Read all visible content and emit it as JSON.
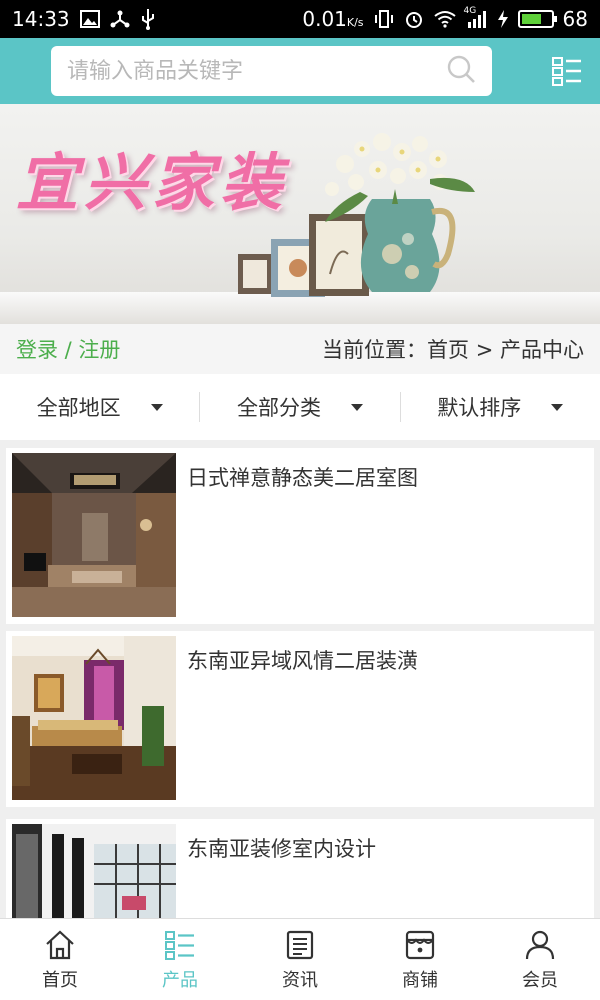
{
  "status_bar": {
    "time": "14:33",
    "net_speed": "0.01",
    "net_unit": "K/s",
    "signal_label": "4G",
    "battery": "68",
    "battery_level": 0.68
  },
  "search": {
    "placeholder": "请输入商品关键字",
    "icon": "search-icon",
    "menu_icon": "list-menu-icon"
  },
  "banner": {
    "title": "宜兴家装"
  },
  "location_bar": {
    "login_link": "登录 / 注册",
    "location": "当前位置：首页 > 产品中心"
  },
  "filters": [
    {
      "label": "全部地区"
    },
    {
      "label": "全部分类"
    },
    {
      "label": "默认排序"
    }
  ],
  "products": [
    {
      "name": "日式禅意静态美二居室图"
    },
    {
      "name": "东南亚异域风情二居装潢"
    },
    {
      "name": "东南亚装修室内设计"
    }
  ],
  "bottom_nav": [
    {
      "label": "首页",
      "icon": "home-icon",
      "active": false
    },
    {
      "label": "产品",
      "icon": "product-list-icon",
      "active": true
    },
    {
      "label": "资讯",
      "icon": "news-icon",
      "active": false
    },
    {
      "label": "商铺",
      "icon": "store-icon",
      "active": false
    },
    {
      "label": "会员",
      "icon": "user-icon",
      "active": false
    }
  ],
  "colors": {
    "accent": "#5bc5c6",
    "login_green": "#4cae4c",
    "banner_title_pink": "#f06ea6"
  }
}
